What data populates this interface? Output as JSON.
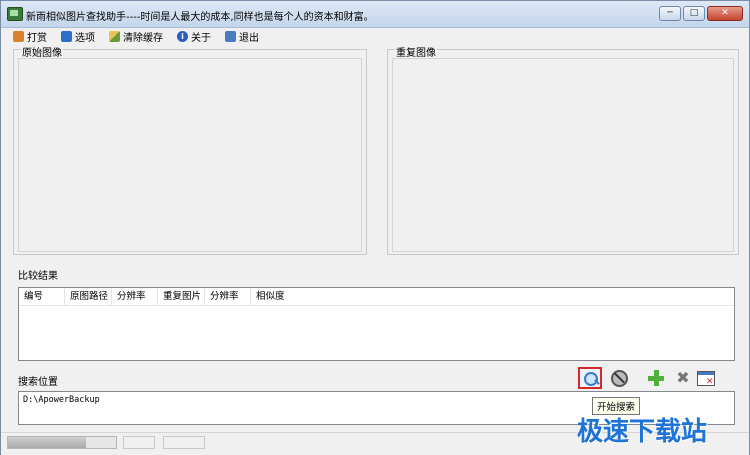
{
  "window": {
    "title": "新雨相似图片查找助手----时间是人最大的成本,同样也是每个人的资本和财富。",
    "buttons": {
      "minimize": "─",
      "maximize": "□",
      "close": "✕"
    }
  },
  "menu": [
    {
      "label": "打赏",
      "icon": "gift-icon"
    },
    {
      "label": "选项",
      "icon": "options-icon"
    },
    {
      "label": "清除缓存",
      "icon": "broom-icon"
    },
    {
      "label": "关于",
      "icon": "info-icon"
    },
    {
      "label": "退出",
      "icon": "exit-icon"
    }
  ],
  "panes": {
    "original": "原始图像",
    "duplicate": "重复图像"
  },
  "results": {
    "label": "比较结果",
    "columns": [
      "编号",
      "原图路径",
      "分辨率",
      "重复图片",
      "分辨率",
      "相似度"
    ]
  },
  "search": {
    "label": "搜索位置",
    "path": "D:\\ApowerBackup",
    "tooltip": "开始搜索"
  },
  "toolbar": {
    "start_search_icon": "search-icon",
    "stop_icon": "stop-icon",
    "add_icon": "plus-icon",
    "delete_icon": "delete-icon",
    "clear_icon": "clear-list-icon"
  },
  "watermark": "极速下载站",
  "colors": {
    "highlight_border": "#d62828",
    "watermark": "#1e73d6"
  }
}
